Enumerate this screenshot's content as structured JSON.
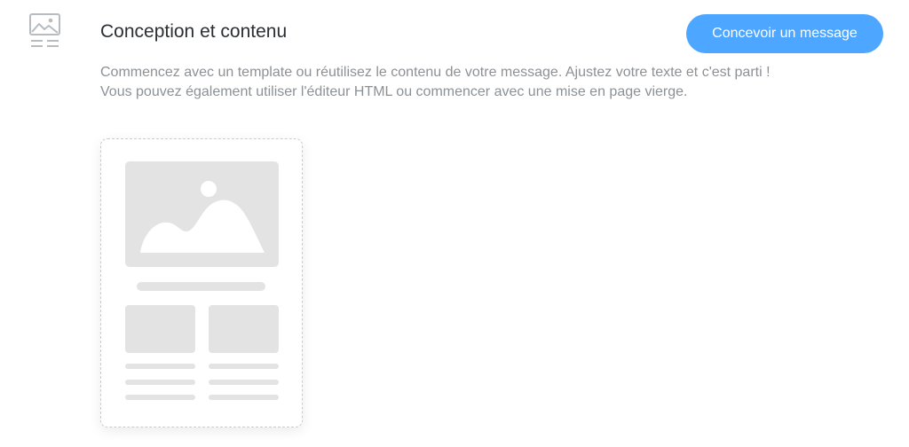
{
  "header": {
    "icon": "image-layout-icon",
    "title": "Conception et contenu",
    "design_button_label": "Concevoir un message"
  },
  "description": {
    "line1": "Commencez avec un template ou réutilisez le contenu de votre message. Ajustez votre texte et c'est parti !",
    "line2": "Vous pouvez également utiliser l'éditeur HTML ou commencer avec une mise en page vierge."
  },
  "template_card": {
    "icon": "email-template-placeholder-icon"
  },
  "colors": {
    "accent": "#4da6ff",
    "title_text": "#2b2f33",
    "muted_text": "#8c9196",
    "placeholder_gray": "#e3e3e3"
  }
}
